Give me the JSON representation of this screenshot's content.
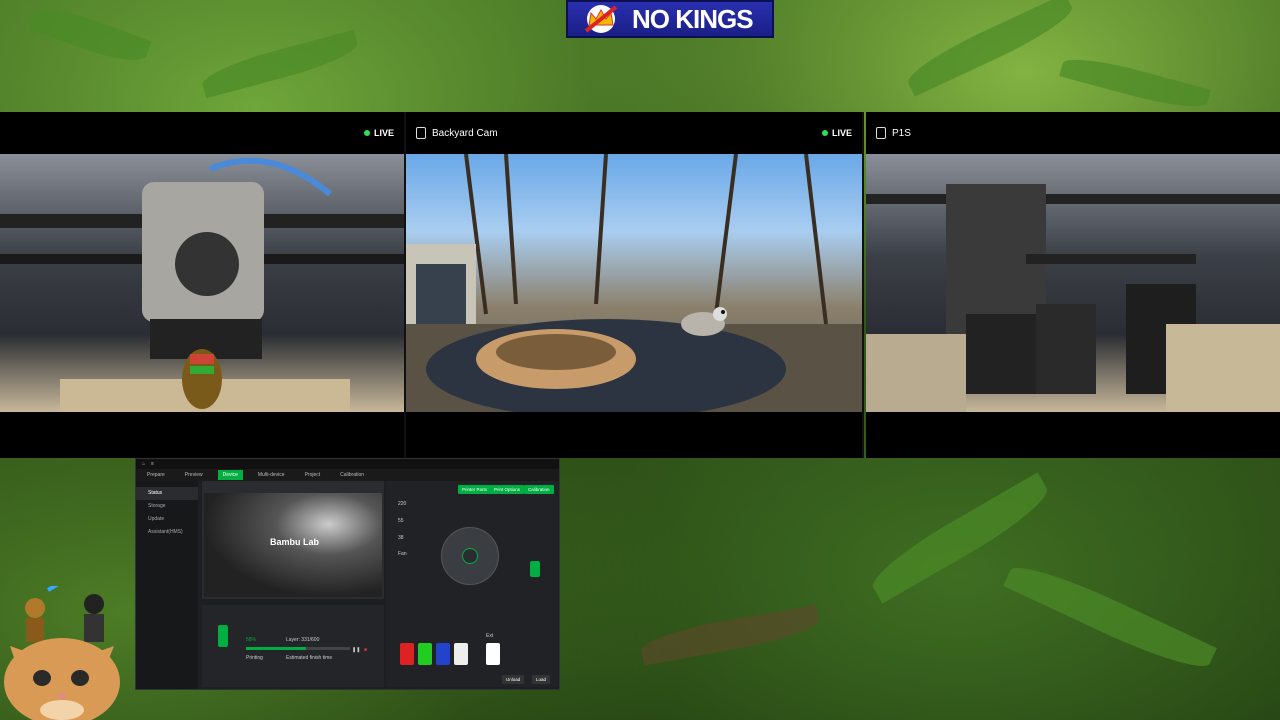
{
  "banner": {
    "text": "NO KINGS"
  },
  "cameras": [
    {
      "title": "",
      "live": "LIVE"
    },
    {
      "title": "Backyard Cam",
      "live": "LIVE"
    },
    {
      "title": "P1S",
      "live": ""
    }
  ],
  "bambu": {
    "tabs": [
      "Prepare",
      "Preview",
      "Device",
      "Multi-device",
      "Project",
      "Calibration"
    ],
    "active_tab": "Device",
    "sidebar": [
      "Status",
      "Storage",
      "Update",
      "Assistant(HMS)"
    ],
    "video_logo": "Bambu Lab",
    "buttons": [
      "Printer Parts",
      "Print Options",
      "Calibration"
    ],
    "temps": [
      "220",
      "55",
      "38"
    ],
    "fan_label": "Fan",
    "progress": {
      "percent": 58,
      "label": "58%",
      "layer": "Layer: 331/600",
      "status": "Printing",
      "remaining": "Estimated finish time"
    },
    "bottom_buttons": [
      "Unload",
      "Load"
    ],
    "ext_label": "Ext"
  }
}
